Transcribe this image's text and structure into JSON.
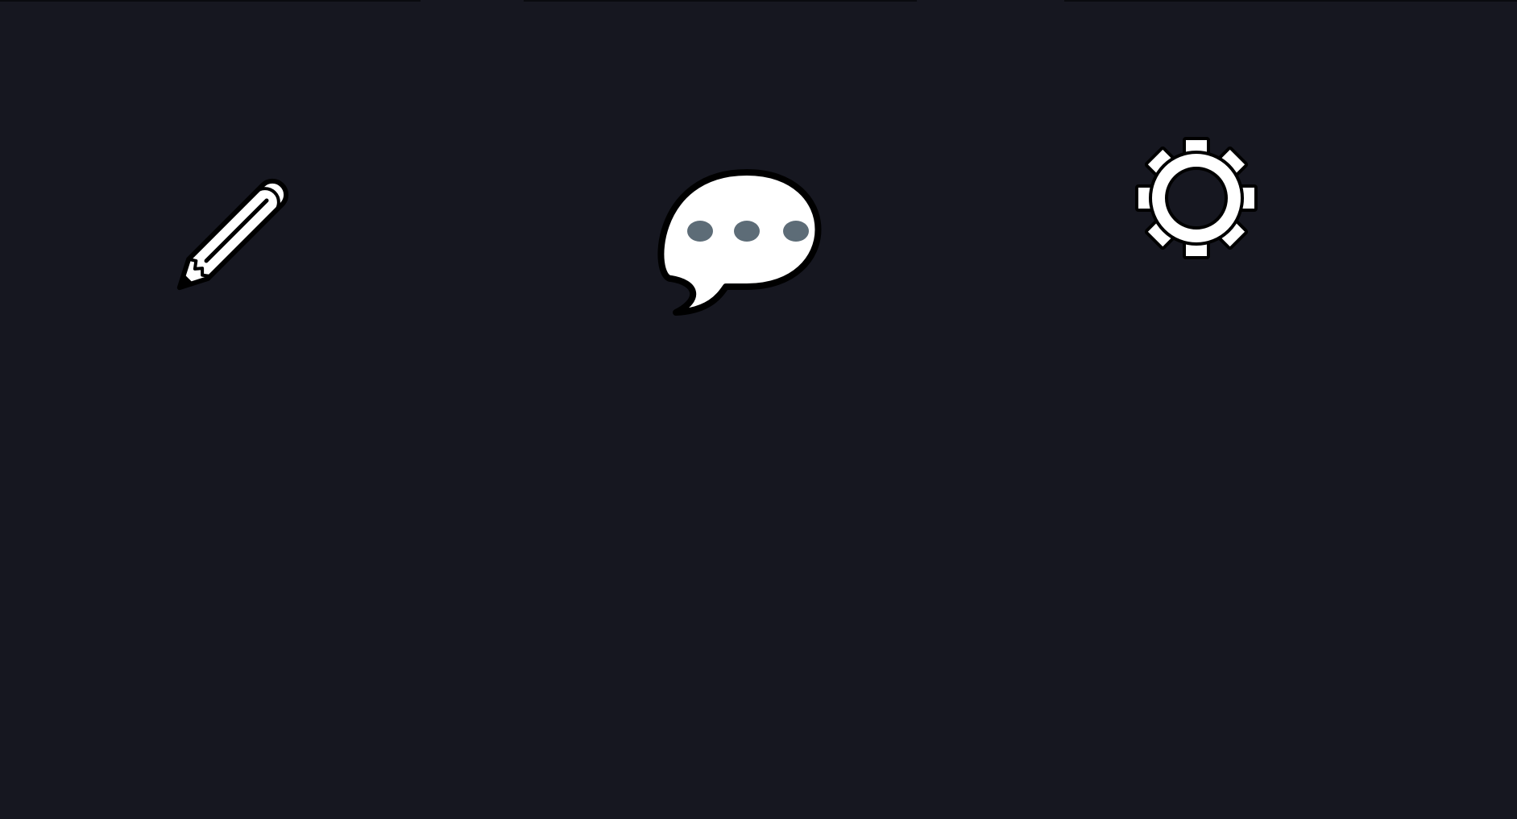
{
  "theme": {
    "background": "#161720",
    "icon_fill": "#ffffff",
    "icon_outline": "#000000",
    "chat_dot_color": "#5d6c77"
  },
  "toolbar": {
    "buttons": [
      {
        "id": "edit",
        "icon": "pencil-icon"
      },
      {
        "id": "chat",
        "icon": "speech-bubble-ellipsis-icon"
      },
      {
        "id": "settings",
        "icon": "gear-icon"
      }
    ]
  }
}
